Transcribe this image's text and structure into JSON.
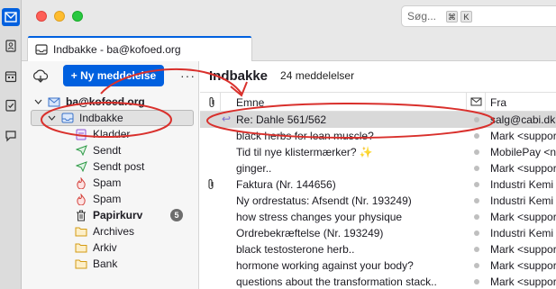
{
  "colors": {
    "accent": "#0060df",
    "annotation_red": "#d9302c"
  },
  "search": {
    "placeholder": "Søg...",
    "key1": "⌘",
    "key2": "K"
  },
  "tab": {
    "title": "Indbakke - ba@kofoed.org"
  },
  "toolbar": {
    "new_message": "+ Ny meddelelse",
    "more": "···"
  },
  "folders": {
    "account": "ba@kofoed.org",
    "items": [
      {
        "label": "Indbakke",
        "icon": "inbox-icon"
      },
      {
        "label": "Kladder",
        "icon": "drafts-icon"
      },
      {
        "label": "Sendt",
        "icon": "sent-icon"
      },
      {
        "label": "Sendt post",
        "icon": "sent-icon"
      },
      {
        "label": "Spam",
        "icon": "spam-icon"
      },
      {
        "label": "Spam",
        "icon": "spam-icon"
      },
      {
        "label": "Papirkurv",
        "icon": "trash-icon",
        "count": "5"
      },
      {
        "label": "Archives",
        "icon": "folder-icon"
      },
      {
        "label": "Arkiv",
        "icon": "folder-icon"
      },
      {
        "label": "Bank",
        "icon": "folder-icon"
      }
    ]
  },
  "thread": {
    "title": "Indbakke",
    "count": "24 meddelelser",
    "columns": {
      "subject": "Emne",
      "from": "Fra"
    },
    "messages": [
      {
        "subject": "Re: Dahle 561/562",
        "from": "salg@cabi.dk",
        "replied": true,
        "attachment": false
      },
      {
        "subject": "black herbs for lean muscle?",
        "from": "Mark <suppor",
        "attachment": false
      },
      {
        "subject": "Tid til nye klistermærker? ✨",
        "from": "MobilePay <no",
        "attachment": false
      },
      {
        "subject": "ginger..",
        "from": "Mark <suppor",
        "attachment": false
      },
      {
        "subject": "Faktura (Nr. 144656)",
        "from": "Industri Kemi",
        "attachment": true
      },
      {
        "subject": "Ny ordrestatus: Afsendt (Nr. 193249)",
        "from": "Industri Kemi",
        "attachment": false
      },
      {
        "subject": "how stress changes your physique",
        "from": "Mark <suppor",
        "attachment": false
      },
      {
        "subject": "Ordrebekræftelse (Nr. 193249)",
        "from": "Industri Kemi",
        "attachment": false
      },
      {
        "subject": "black testosterone herb..",
        "from": "Mark <suppor",
        "attachment": false
      },
      {
        "subject": "hormone working against your body?",
        "from": "Mark <suppor",
        "attachment": false
      },
      {
        "subject": "questions about the transformation stack..",
        "from": "Mark <suppor",
        "attachment": false
      }
    ]
  }
}
